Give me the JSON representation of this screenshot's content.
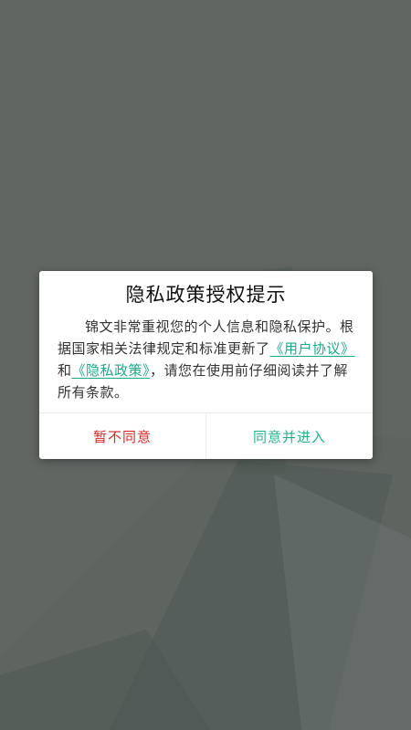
{
  "dialog": {
    "title": "隐私政策授权提示",
    "body_prefix": "锦文非常重视您的个人信息和隐私保护。根据国家相关法律规定和标准更新了",
    "user_agreement_link": "《用户协议》",
    "conjunction": "和",
    "privacy_policy_link": "《隐私政策》",
    "body_suffix": "，请您在使用前仔细阅读并了解所有条款。",
    "decline_label": "暂不同意",
    "accept_label": "同意并进入"
  },
  "colors": {
    "overlay": "#626663",
    "link": "#1fa889",
    "decline": "#d12a2a",
    "accept": "#25b08b"
  }
}
